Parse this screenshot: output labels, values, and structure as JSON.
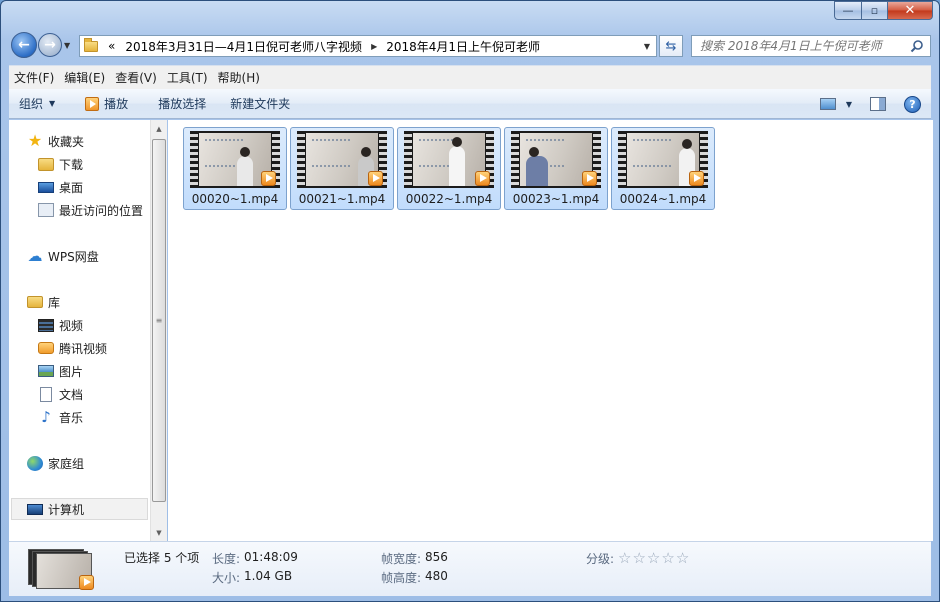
{
  "window": {
    "caption": {
      "minimize": "—",
      "maximize": "▫",
      "close": "✕"
    }
  },
  "address": {
    "overflow": "«",
    "crumbs": [
      "2018年3月31日—4月1日倪可老师八字视频",
      "2018年4月1日上午倪可老师"
    ]
  },
  "search": {
    "placeholder": "搜索 2018年4月1日上午倪可老师"
  },
  "menu": [
    "文件(F)",
    "编辑(E)",
    "查看(V)",
    "工具(T)",
    "帮助(H)"
  ],
  "toolbar": {
    "organize": "组织",
    "play": "播放",
    "play_selection": "播放选择",
    "new_folder": "新建文件夹",
    "help": "?"
  },
  "navpane": {
    "favorites": "收藏夹",
    "downloads": "下载",
    "desktop": "桌面",
    "recent": "最近访问的位置",
    "wps": "WPS网盘",
    "libraries": "库",
    "videos": "视频",
    "tencent_video": "腾讯视频",
    "pictures": "图片",
    "documents": "文档",
    "music": "音乐",
    "homegroup": "家庭组",
    "computer": "计算机"
  },
  "files": [
    {
      "name": "00020~1.mp4"
    },
    {
      "name": "00021~1.mp4"
    },
    {
      "name": "00022~1.mp4"
    },
    {
      "name": "00023~1.mp4"
    },
    {
      "name": "00024~1.mp4"
    }
  ],
  "details": {
    "selected": "已选择 5 个项",
    "length_label": "长度:",
    "length": "01:48:09",
    "size_label": "大小:",
    "size": "1.04 GB",
    "frame_width_label": "帧宽度:",
    "frame_width": "856",
    "frame_height_label": "帧高度:",
    "frame_height": "480",
    "rating_label": "分级:",
    "rating": 0,
    "rating_max": 5
  }
}
